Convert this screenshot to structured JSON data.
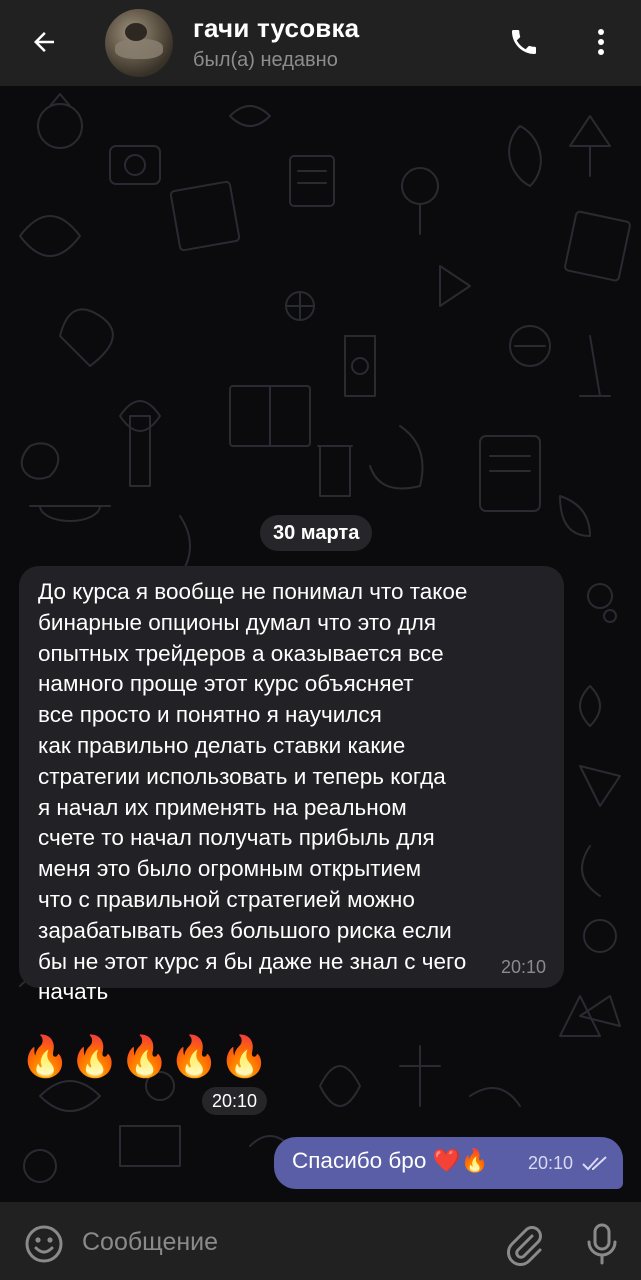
{
  "header": {
    "back_icon": "arrow-left-icon",
    "title": "гачи тусовка",
    "status": "был(а) недавно",
    "call_icon": "phone-icon",
    "menu_icon": "more-vertical-icon"
  },
  "chat": {
    "date": "30 марта",
    "incoming_message": {
      "text": "До курса я вообще не понимал что такое\nбинарные опционы думал что это для\nопытных трейдеров а оказывается все\nнамного проще этот курс объясняет\nвсе просто и понятно я научился\nкак правильно делать ставки какие\nстратегии использовать и теперь когда\nя начал их применять на реальном\nсчете то начал получать прибыль для\nменя это было огромным открытием\nчто с правильной стратегией можно\nзарабатывать без большого риска если\nбы не этот курс я бы даже не знал с чего\nначать",
      "time": "20:10"
    },
    "emoji_message": {
      "text": "🔥🔥🔥🔥🔥",
      "time": "20:10"
    },
    "outgoing_message": {
      "text": "Спасибо бро ❤️🔥",
      "time": "20:10",
      "status_icon": "double-check-icon"
    }
  },
  "input_bar": {
    "emoji_icon": "smiley-icon",
    "placeholder": "Сообщение",
    "attach_icon": "paperclip-icon",
    "mic_icon": "microphone-icon"
  },
  "colors": {
    "header_bg": "#212121",
    "chat_bg": "#0b0b0d",
    "incoming_bubble": "#222226",
    "outgoing_bubble": "#5a5ea6",
    "pill_bg": "#26262a",
    "muted_text": "#8d8d8d"
  }
}
